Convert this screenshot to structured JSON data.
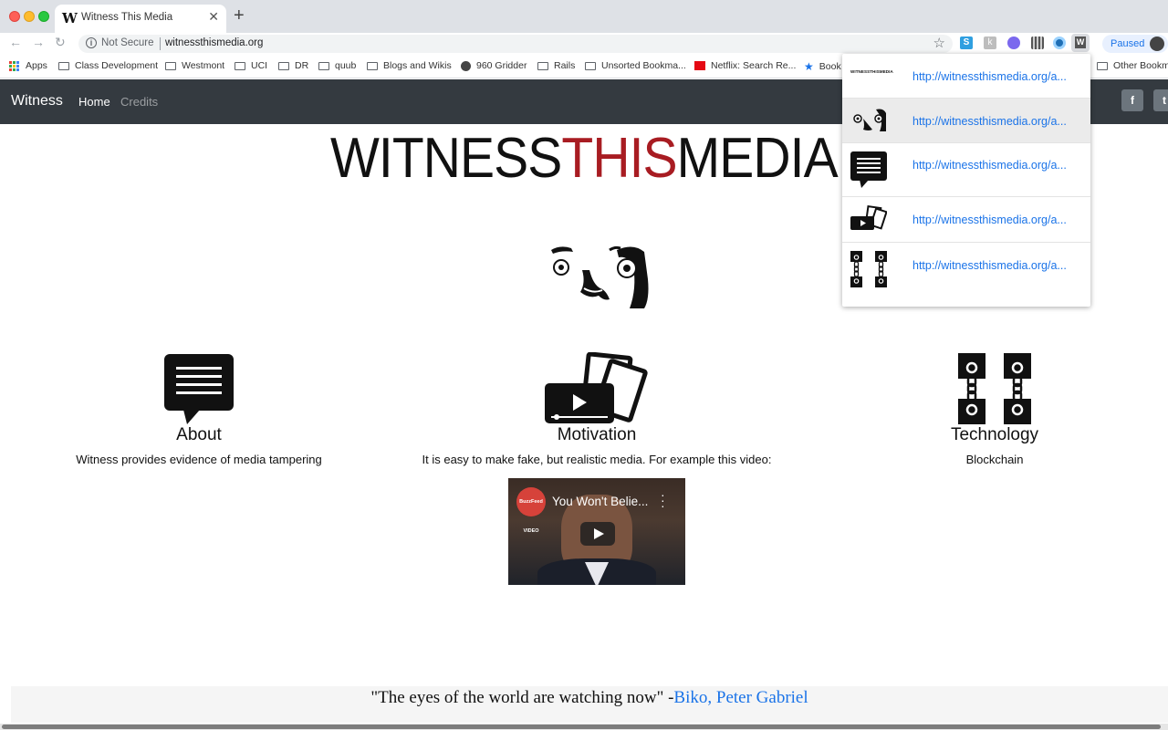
{
  "browser": {
    "tab_title": "Witness This Media",
    "tab_favicon": "W",
    "security_label": "Not Secure",
    "url": "witnessthismedia.org",
    "profile_label": "Paused",
    "bookmarks": [
      {
        "label": "Apps",
        "icon": "apps-grid-icon"
      },
      {
        "label": "Class Development",
        "icon": "folder-icon"
      },
      {
        "label": "Westmont",
        "icon": "folder-icon"
      },
      {
        "label": "UCI",
        "icon": "folder-icon"
      },
      {
        "label": "DR",
        "icon": "folder-icon"
      },
      {
        "label": "quub",
        "icon": "folder-icon"
      },
      {
        "label": "Blogs and Wikis",
        "icon": "folder-icon"
      },
      {
        "label": "960 Gridder",
        "icon": "globe-icon"
      },
      {
        "label": "Rails",
        "icon": "folder-icon"
      },
      {
        "label": "Unsorted Bookma...",
        "icon": "folder-icon"
      },
      {
        "label": "Netflix: Search Re...",
        "icon": "netflix-icon"
      },
      {
        "label": "Book",
        "icon": "star-icon"
      },
      {
        "label": "Other Bookmarks",
        "icon": "folder-icon"
      }
    ],
    "extension_icons": [
      "s-extension-icon",
      "k-extension-icon",
      "ghost-extension-icon",
      "barcode-extension-icon",
      "circle-extension-icon",
      "witness-extension-icon"
    ]
  },
  "site": {
    "brand": "Witness",
    "nav": {
      "home": "Home",
      "credits": "Credits"
    },
    "social": {
      "facebook": "f",
      "twitter": "t"
    },
    "logo": {
      "part1": "WITNESS",
      "part2": "THIS",
      "part3": "MEDIA"
    },
    "accent_color": "#a81c22",
    "features": [
      {
        "title": "About",
        "text": "Witness provides evidence of media tampering",
        "icon": "speech-bubble-icon"
      },
      {
        "title": "Motivation",
        "text": "It is easy to make fake, but realistic media. For example this video:",
        "icon": "video-cards-icon"
      },
      {
        "title": "Technology",
        "text": "Blockchain",
        "icon": "chain-blocks-icon"
      }
    ],
    "video": {
      "title": "You Won't Belie...",
      "badge": "BuzzFeed VIDEO"
    },
    "quote": {
      "text": "\"The eyes of the world are watching now\" -",
      "link": "Biko, Peter Gabriel"
    }
  },
  "popup": {
    "items": [
      {
        "link": "http://witnessthismedia.org/a...",
        "thumb": "logo-thumb-icon",
        "thumb_text": "WITNESSTHISMEDIA"
      },
      {
        "link": "http://witnessthismedia.org/a...",
        "thumb": "mascot-thumb-icon"
      },
      {
        "link": "http://witnessthismedia.org/a...",
        "thumb": "speech-bubble-thumb-icon"
      },
      {
        "link": "http://witnessthismedia.org/a...",
        "thumb": "video-cards-thumb-icon"
      },
      {
        "link": "http://witnessthismedia.org/a...",
        "thumb": "chain-blocks-thumb-icon"
      }
    ]
  }
}
